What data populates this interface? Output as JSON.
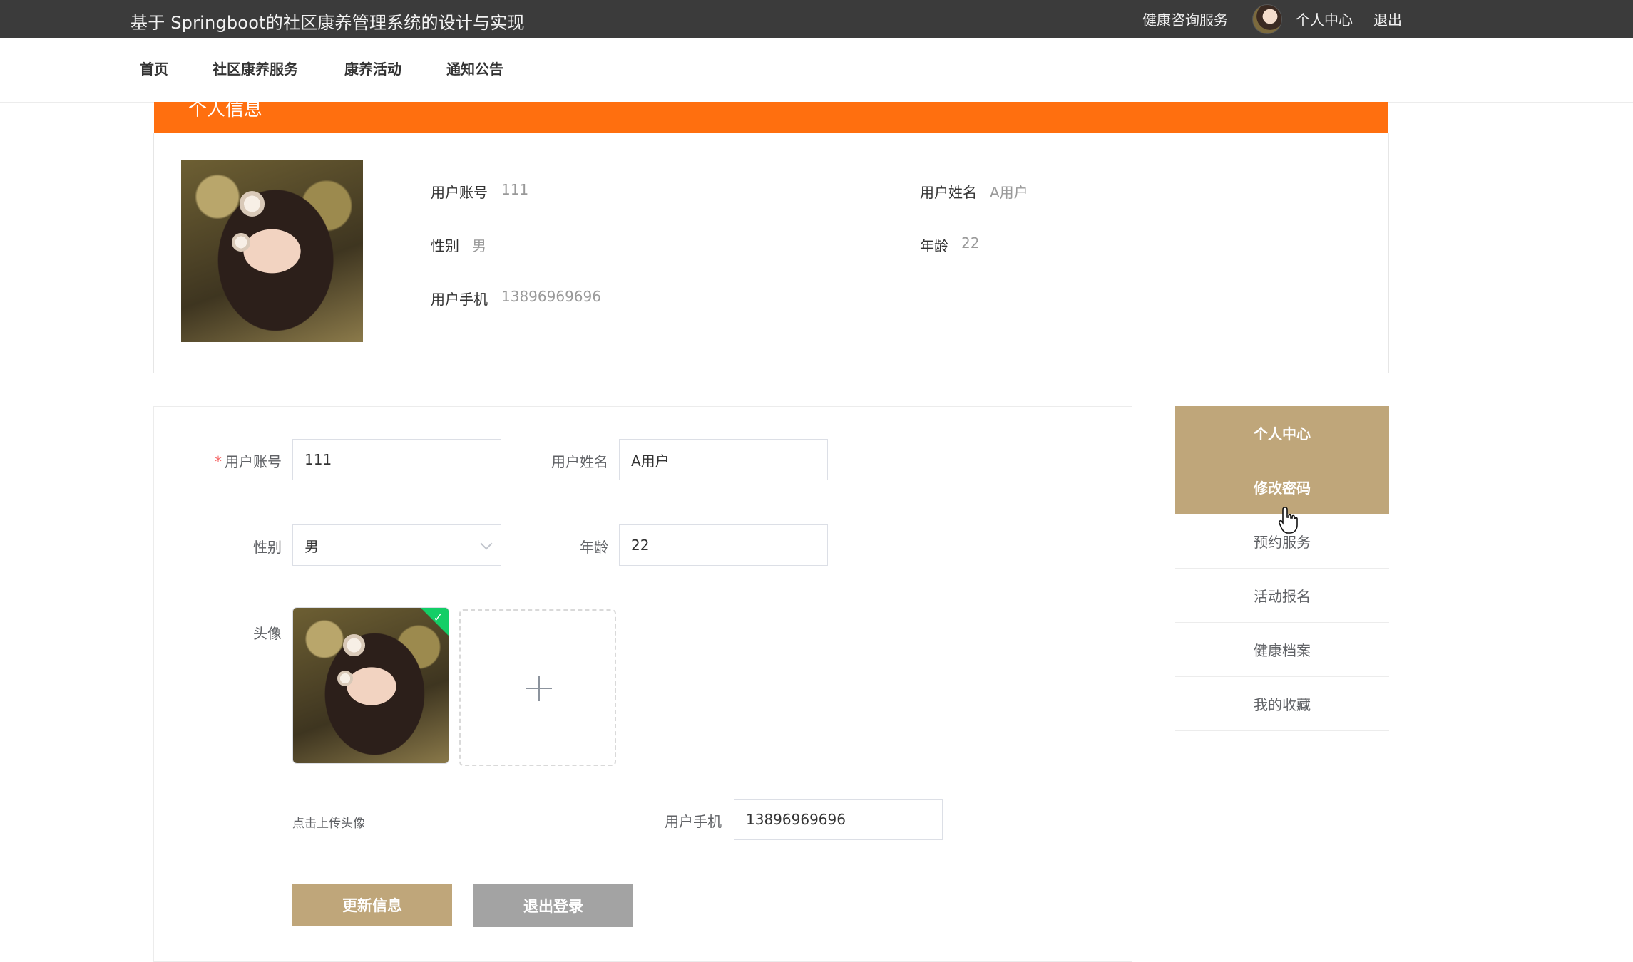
{
  "app": {
    "title": "基于 Springboot的社区康养管理系统的设计与实现"
  },
  "topbar": {
    "links": {
      "consult": "健康咨询服务",
      "profile": "个人中心",
      "logout": "退出"
    }
  },
  "nav": {
    "items": [
      "首页",
      "社区康养服务",
      "康养活动",
      "通知公告"
    ]
  },
  "info": {
    "header": "个人信息",
    "fields": {
      "account_label": "用户账号",
      "account_value": "111",
      "name_label": "用户姓名",
      "name_value": "A用户",
      "gender_label": "性别",
      "gender_value": "男",
      "age_label": "年龄",
      "age_value": "22",
      "phone_label": "用户手机",
      "phone_value": "13896969696"
    }
  },
  "form": {
    "account_label": "用户账号",
    "account_value": "111",
    "name_label": "用户姓名",
    "name_value": "A用户",
    "gender_label": "性别",
    "gender_value": "男",
    "age_label": "年龄",
    "age_value": "22",
    "avatar_label": "头像",
    "upload_tip": "点击上传头像",
    "phone_label": "用户手机",
    "phone_value": "13896969696",
    "update_button": "更新信息",
    "logout_button": "退出登录"
  },
  "side_menu": {
    "items": [
      "个人中心",
      "修改密码",
      "预约服务",
      "活动报名",
      "健康档案",
      "我的收藏"
    ],
    "active": [
      "个人中心",
      "修改密码"
    ]
  },
  "colors": {
    "topbar": "#3b3b3b",
    "info_header": "#ff6f0f",
    "accent": "#bfa67a",
    "secondary_button": "#a3a3a3",
    "success": "#13ce66"
  },
  "icons": {
    "upload": "plus-icon",
    "uploaded": "check-icon",
    "select": "chevron-down-icon",
    "cursor": "hand-pointer-icon"
  }
}
